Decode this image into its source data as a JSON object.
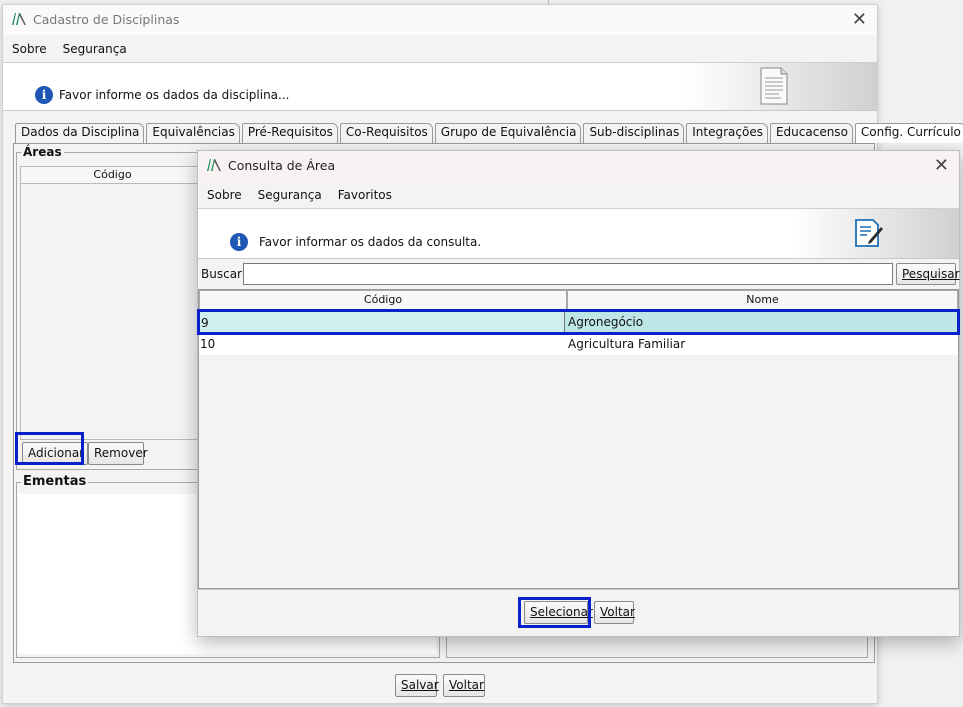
{
  "main_window": {
    "title": "Cadastro de Disciplinas",
    "menu": [
      "Sobre",
      "Segurança"
    ],
    "info_message": "Favor informe os dados da disciplina...",
    "tabs": [
      "Dados da Disciplina",
      "Equivalências",
      "Pré-Requisitos",
      "Co-Requisitos",
      "Grupo de Equivalência",
      "Sub-disciplinas",
      "Integrações",
      "Educacenso",
      "Config. Currículo"
    ],
    "active_tab": "Config. Currículo",
    "areas_group": {
      "label": "Áreas",
      "column_header": "Código",
      "add_button": "Adicionar",
      "remove_button": "Remover"
    },
    "ementas_group": {
      "label": "Ementas"
    },
    "footer": {
      "save_button": "Salvar",
      "back_button": "Voltar"
    }
  },
  "dialog": {
    "title": "Consulta de Área",
    "menu": [
      "Sobre",
      "Segurança",
      "Favoritos"
    ],
    "info_message": "Favor informar os dados da consulta.",
    "search": {
      "label": "Buscar:",
      "value": "",
      "button": "Pesquisar"
    },
    "table": {
      "columns": [
        "Código",
        "Nome"
      ],
      "rows": [
        {
          "codigo": "9",
          "nome": "Agronegócio",
          "selected": true
        },
        {
          "codigo": "10",
          "nome": "Agricultura Familiar",
          "selected": false
        }
      ]
    },
    "footer": {
      "select_button": "Selecionar",
      "back_button": "Voltar"
    }
  },
  "colors": {
    "highlight": "#0a21c9",
    "selected_row": "#bfe6e6",
    "info_icon": "#1f57b4"
  }
}
